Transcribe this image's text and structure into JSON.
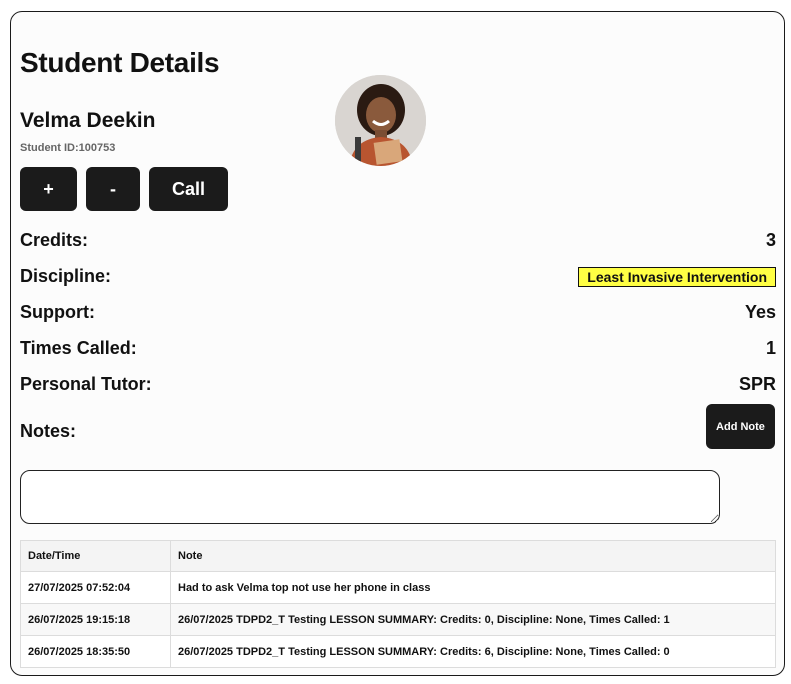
{
  "page": {
    "title": "Student Details"
  },
  "student": {
    "name": "Velma Deekin",
    "id_label": "Student ID:100753"
  },
  "actions": {
    "increment_label": "+",
    "decrement_label": "-",
    "call_label": "Call"
  },
  "details": [
    {
      "label": "Credits:",
      "value": "3"
    },
    {
      "label": "Discipline:",
      "value": "Least Invasive Intervention",
      "highlight_color": "#ffff44"
    },
    {
      "label": "Support:",
      "value": "Yes"
    },
    {
      "label": "Times Called:",
      "value": "1"
    },
    {
      "label": "Personal Tutor:",
      "value": "SPR"
    }
  ],
  "notes": {
    "label": "Notes:",
    "add_label": "Add Note",
    "input_value": "",
    "columns": [
      "Date/Time",
      "Note"
    ],
    "rows": [
      {
        "datetime": "27/07/2025 07:52:04",
        "note": "Had to ask Velma top not use her phone in class"
      },
      {
        "datetime": "26/07/2025 19:15:18",
        "note": "26/07/2025 TDPD2_T Testing LESSON SUMMARY: Credits: 0, Discipline: None, Times Called: 1"
      },
      {
        "datetime": "26/07/2025 18:35:50",
        "note": "26/07/2025 TDPD2_T Testing LESSON SUMMARY: Credits: 6, Discipline: None, Times Called: 0"
      }
    ]
  },
  "colors": {
    "button_bg": "#1b1b1b",
    "discipline_badge": "#ffff44"
  }
}
